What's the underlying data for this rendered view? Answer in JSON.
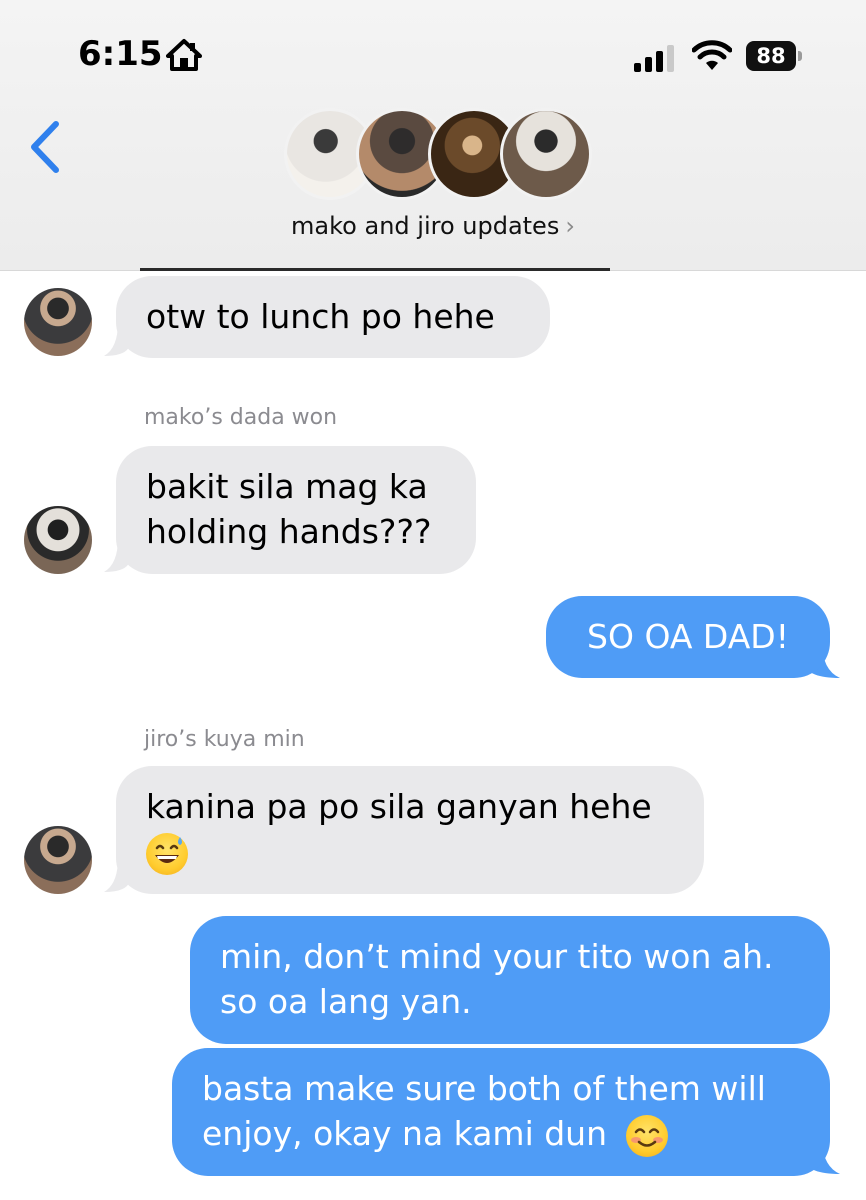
{
  "status_bar": {
    "time": "6:15",
    "battery": "88",
    "icons": [
      "home-icon",
      "signal-icon",
      "wifi-icon",
      "battery-icon"
    ]
  },
  "nav": {
    "back_icon": "chevron-left-icon",
    "group_name": "mako and jiro updates",
    "group_chevron": "›"
  },
  "messages": [
    {
      "direction": "incoming",
      "sender": "",
      "text": "otw to lunch po hehe"
    },
    {
      "direction": "incoming",
      "sender": "mako’s dada won",
      "text_lines": [
        "bakit sila mag ka",
        "holding hands???"
      ]
    },
    {
      "direction": "outgoing",
      "text": "SO OA DAD!"
    },
    {
      "direction": "incoming",
      "sender": "jiro’s kuya min",
      "text_lines": [
        "kanina pa po sila ganyan hehe"
      ],
      "emoji": "grinning-sweat-emoji"
    },
    {
      "direction": "outgoing",
      "text_lines": [
        "min, don’t mind your tito won ah.",
        "so oa lang yan."
      ]
    },
    {
      "direction": "outgoing",
      "text_lines": [
        "basta make sure both of them will",
        "enjoy, okay na kami dun"
      ],
      "emoji": "smiling-emoji"
    }
  ],
  "colors": {
    "outgoing_bubble": "#4f9cf6",
    "incoming_bubble": "#e9e9eb",
    "accent": "#2f80ed",
    "sender_label": "#8b8b90"
  }
}
